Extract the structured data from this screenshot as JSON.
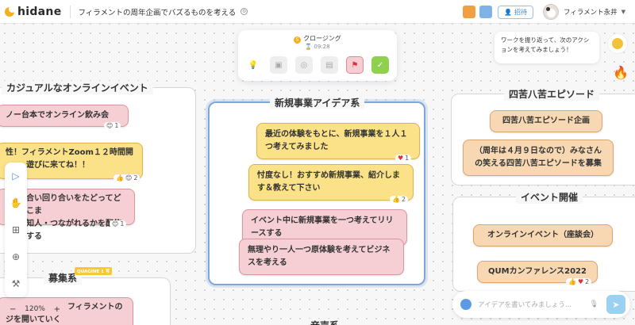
{
  "header": {
    "logo_text": "hidane",
    "project_title": "フィラメントの周年企画でバズるものを考える",
    "invite_label": "招待",
    "user_name": "フィラメント永井"
  },
  "step_bar": {
    "step_number": "5",
    "title": "クロージング",
    "time": "09:28"
  },
  "tip": {
    "text": "ワークを振り返って、次のアクションを考えてみましょう！"
  },
  "groups": {
    "casual": {
      "title": "カジュアルなオンラインイベント"
    },
    "new_biz": {
      "title": "新規事業アイデア系"
    },
    "shiku": {
      "title": "四苦八苦エピソード"
    },
    "event": {
      "title": "イベント開催"
    },
    "recruit": {
      "title": "募集系"
    },
    "music": {
      "title": "音声系"
    }
  },
  "stickies": {
    "c1": "ノー台本でオンライン飲み会",
    "c2a": "性！フィラメントZoom１２時間開",
    "c2b": "遊びに来てね！！",
    "c3a": "合い回り合いをたどってどこま",
    "c3b": "知人・つながれるかを配信する",
    "n1": "最近の体験をもとに、新規事業を１人１つ考えてみました",
    "n2": "忖度なし！おすすめ新規事業、紹介します＆教えて下さい",
    "n3": "イベント中に新規事業を一つ考えてリリースする",
    "n4": "無理やり一人一つ原体験を考えてビジネスを考える",
    "s1": "四苦八苦エピソード企画",
    "s2": "（周年は４月９日なので）みなさんの笑える四苦八苦エピソードを募集",
    "e1": "オンラインイベント（座談会）",
    "e2": "QUMカンファレンス2022",
    "r1": "フィラメントの",
    "r2": "ジを開いていく"
  },
  "reactions": {
    "c1": "1",
    "c2": "2",
    "c3": "1",
    "n1": "1",
    "n2": "2",
    "e2": "2"
  },
  "badge": {
    "label": "QUAGINE 1 写"
  },
  "zoom": {
    "minus": "−",
    "level": "120%",
    "plus": "+"
  },
  "idea_input": {
    "placeholder": "アイデアを書いてみましょう..."
  },
  "colors": {
    "accent": "#4a8fe0",
    "pink": "#f6cfd4",
    "yellow": "#fbe288",
    "tan": "#f7d8b3"
  }
}
